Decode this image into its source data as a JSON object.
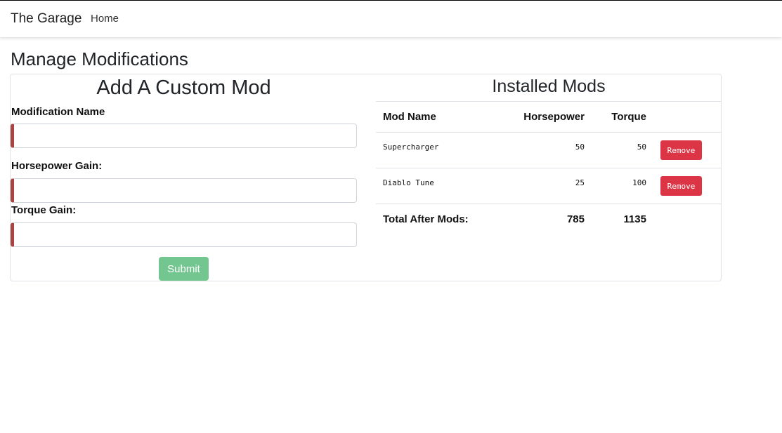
{
  "navbar": {
    "brand": "The Garage",
    "links": [
      "Home"
    ]
  },
  "page": {
    "title": "Manage Modifications"
  },
  "form": {
    "title": "Add A Custom Mod",
    "fields": [
      {
        "label": "Modification Name",
        "value": "",
        "placeholder": ""
      },
      {
        "label": "Horsepower Gain:",
        "value": "",
        "placeholder": ""
      },
      {
        "label": "Torque Gain:",
        "value": "",
        "placeholder": ""
      }
    ],
    "submit_label": "Submit"
  },
  "installed": {
    "title": "Installed Mods",
    "columns": [
      "Mod Name",
      "Horsepower",
      "Torque",
      ""
    ],
    "rows": [
      {
        "name": "Supercharger",
        "horsepower": "50",
        "torque": "50",
        "action": "Remove"
      },
      {
        "name": "Diablo Tune",
        "horsepower": "25",
        "torque": "100",
        "action": "Remove"
      }
    ],
    "totals": {
      "label": "Total After Mods:",
      "horsepower": "785",
      "torque": "1135"
    }
  },
  "colors": {
    "submit": "#74c690",
    "remove": "#dc3545",
    "input_invalid_border": "#a94442"
  }
}
